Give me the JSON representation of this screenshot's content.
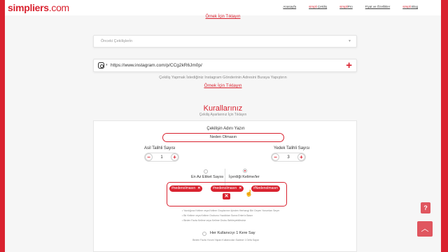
{
  "brand": {
    "logo_text": "simpliers",
    "logo_domain": ".com",
    "accent": "#d9222f"
  },
  "nav": [
    {
      "label": "Anasayfa"
    },
    {
      "brand": "simpli",
      "label": " Çekiliş"
    },
    {
      "brand": "simpli",
      "label": "Pro"
    },
    {
      "label": "Fiyat ve Özellikler"
    },
    {
      "brand": "simpli",
      "label": " Blog"
    }
  ],
  "top_example_link": "Örnek İçin Tıklayın",
  "previous_giveaways": {
    "placeholder": "Önceki Çekilişleri̇n",
    "icon": "chevron-down-icon"
  },
  "post_url": {
    "value": "https://www.instagram.com/p/CCg2kR6Jm0p/",
    "icon": "instagram-icon"
  },
  "post_hint": "Çekiliş Yapmak İstediğiniz Instagram Gönderinin Adresini Buraya Yapıştırın",
  "example_link": "Örnek İçin Tıklayın",
  "rules": {
    "title": "Kurallarınız",
    "subtitle": "Çekiliş Ayarlarınız İçin Tıklayın",
    "name_label": "Çekilişin Adını Yazın",
    "name_value": "Neden Olmasın",
    "winners_label": "Asil Talihli Sayısı",
    "winners_value": "1",
    "reserve_label": "Yedek Talihli Sayısı",
    "reserve_value": "3",
    "min_tag_label": "En Az Etiket Sayısı",
    "keywords_label": "İçerdiği Kelime/ler",
    "keywords": [
      "#nedenolmasın",
      "#nedenolmasın",
      "#Nedenolmasın"
    ],
    "bullets": [
      "• Yazdığınız Kelime veya Kelime Gruplarının İçinden Herhangi Biri Geçen Yorumları Seçer",
      "• Bir Kelime veya Kelime Grubunu Yazdıktan Sonra Enter'a Basın",
      "• Birden Fazla Kelime veya Kelime Grubu Belirleyebilirsiniz"
    ],
    "once_label": "Her Kullanıcıyı 1 Kere Say",
    "once_note": "Birden Fazla Yorum Yapan Kullanıcıları Sadece 1 Defa Sayar"
  },
  "help_label": "?",
  "scroll_top_icon": "chevron-up-icon"
}
